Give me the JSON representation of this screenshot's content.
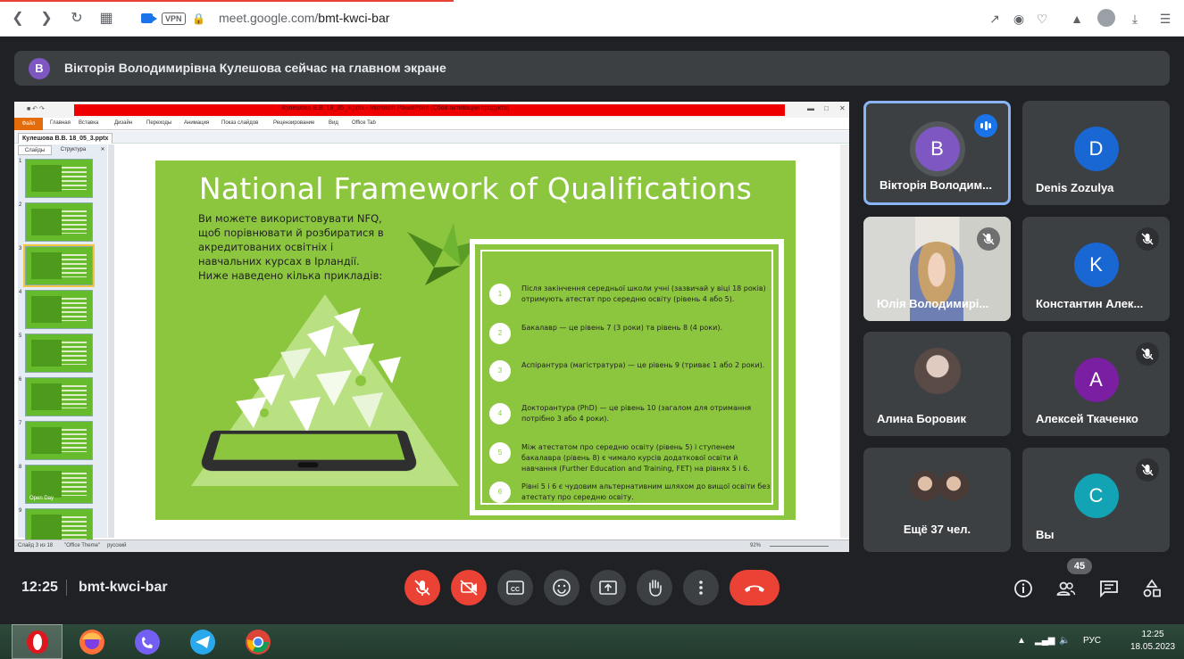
{
  "browser": {
    "url_prefix": "meet.google.com/",
    "url_path": "bmt-kwci-bar",
    "vpn_label": "VPN"
  },
  "banner": {
    "avatar_letter": "B",
    "text": "Вікторія Володимирівна Кулешова сейчас на главном экране"
  },
  "presentation": {
    "window_title": "Кулешова В.В. 18_05_3.pptx - Microsoft PowerPoint (Сбой активации продукта)",
    "menu": [
      "Файл",
      "Главная",
      "Вставка",
      "Дизайн",
      "Переходы",
      "Анимация",
      "Показ слайдов",
      "Рецензирование",
      "Вид",
      "Office Tab"
    ],
    "doc_tab": "Кулешова В.В. 18_05_3.pptx",
    "pane_tabs": [
      "Слайды",
      "Структура"
    ],
    "thumbnails": [
      "1",
      "2",
      "3",
      "4",
      "5",
      "6",
      "7",
      "8",
      "9"
    ],
    "thumb_caption_8": "Open Day",
    "status_slide": "Слайд 3 из 18",
    "status_theme": "\"Office Theme\"",
    "status_lang": "русский",
    "status_zoom": "92%",
    "slide": {
      "title": "National Framework of Qualifications",
      "intro": "Ви можете використовувати NFQ, щоб порівнювати й розбиратися в акредитованих освітніх і навчальних курсах в Ірландії. Ниже наведено кілька прикладів:",
      "steps": [
        {
          "num": "1",
          "text": "Після закінчення середньої школи учні (зазвичай у віці 18 років) отримують атестат про середню освіту (рівень 4 або 5)."
        },
        {
          "num": "2",
          "text": "Бакалавр — це рівень 7 (3 роки) та рівень 8 (4 роки)."
        },
        {
          "num": "3",
          "text": "Аспірантура (магістратура) — це рівень 9 (триває 1 або 2 роки)."
        },
        {
          "num": "4",
          "text": "Докторантура (PhD) — це рівень 10 (загалом для отримання потрібно 3 або 4 роки)."
        },
        {
          "num": "5",
          "text": "Між атестатом про середню освіту (рівень 5) і ступенем бакалавра (рівень 8) є чимало курсів додаткової освіти й навчання (Further Education and Training, FET) на рівнях 5 і 6."
        },
        {
          "num": "6",
          "text": "Рівні 5 і 6 є чудовим альтернативним шляхом до вищої освіти без атестату про середню освіту."
        }
      ]
    }
  },
  "participants": [
    {
      "name": "Вікторія Володим...",
      "letter": "B",
      "color": "#7e57c2",
      "muted": false,
      "speaking": true,
      "photo": false
    },
    {
      "name": "Denis Zozulya",
      "letter": "D",
      "color": "#1967d2",
      "muted": false,
      "speaking": false,
      "photo": false
    },
    {
      "name": "Юлія Володимирі...",
      "letter": "",
      "color": "",
      "muted": true,
      "speaking": false,
      "photo": true
    },
    {
      "name": "Константин Алек...",
      "letter": "K",
      "color": "#1967d2",
      "muted": true,
      "speaking": false,
      "photo": false
    },
    {
      "name": "Алина Боровик",
      "letter": "",
      "color": "",
      "muted": false,
      "speaking": false,
      "photo": true
    },
    {
      "name": "Алексей Ткаченко",
      "letter": "A",
      "color": "#7b1fa2",
      "muted": true,
      "speaking": false,
      "photo": false
    },
    {
      "name": "Ещё 37 чел.",
      "letter": "",
      "color": "",
      "muted": false,
      "speaking": false,
      "photo": false
    },
    {
      "name": "Вы",
      "letter": "C",
      "color": "#12a4b4",
      "muted": true,
      "speaking": false,
      "photo": false
    }
  ],
  "meeting": {
    "time": "12:25",
    "code": "bmt-kwci-bar",
    "participant_count": "45"
  },
  "taskbar": {
    "lang": "РУС",
    "clock_time": "12:25",
    "clock_date": "18.05.2023"
  },
  "colors": {
    "meet_bg": "#202124",
    "tile_bg": "#3c4043",
    "danger": "#ea4335",
    "slide_green": "#8cc63f"
  }
}
